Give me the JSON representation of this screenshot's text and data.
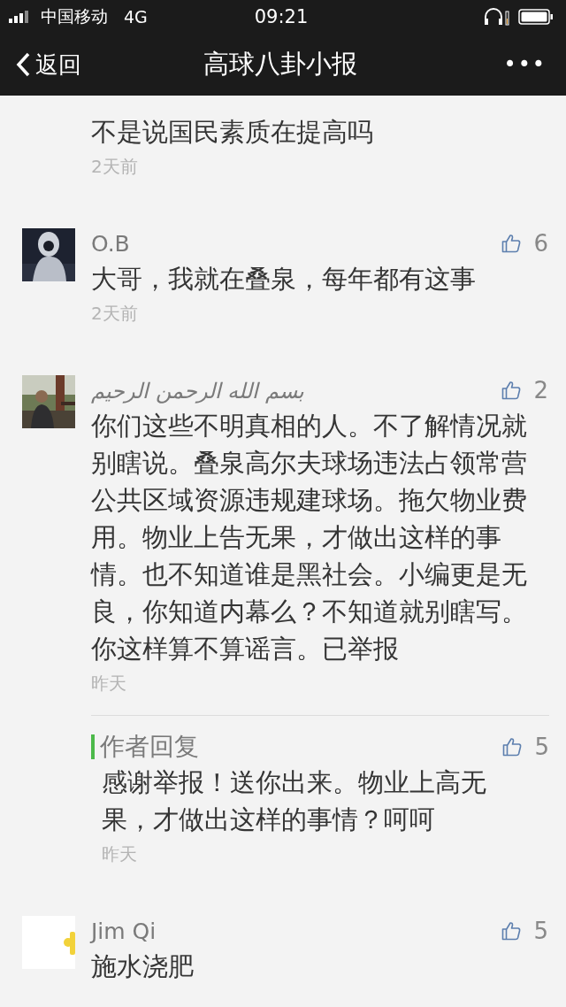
{
  "status_bar": {
    "carrier": "中国移动",
    "network": "4G",
    "time": "09:21"
  },
  "nav": {
    "back": "返回",
    "title": "高球八卦小报",
    "more": "•••"
  },
  "comments": [
    {
      "kind": "partial",
      "text": "不是说国民素质在提高吗",
      "time": "2天前"
    },
    {
      "kind": "comment",
      "name": "O.B",
      "text": "大哥，我就在叠泉，每年都有这事",
      "time": "2天前",
      "likes": "6"
    },
    {
      "kind": "comment",
      "name": "بسم الله الرحمن الرحيم",
      "text": "你们这些不明真相的人。不了解情况就别瞎说。叠泉高尔夫球场违法占领常营公共区域资源违规建球场。拖欠物业费用。物业上告无果，才做出这样的事情。也不知道谁是黑社会。小编更是无良，你知道内幕么？不知道就别瞎写。你这样算不算谣言。已举报",
      "time": "昨天",
      "likes": "2",
      "reply": {
        "label": "作者回复",
        "text": "感谢举报！送你出来。物业上高无果，才做出这样的事情？呵呵",
        "time": "昨天",
        "likes": "5"
      }
    },
    {
      "kind": "comment",
      "name": "Jim Qi",
      "text": "施水浇肥",
      "likes": "5"
    }
  ]
}
